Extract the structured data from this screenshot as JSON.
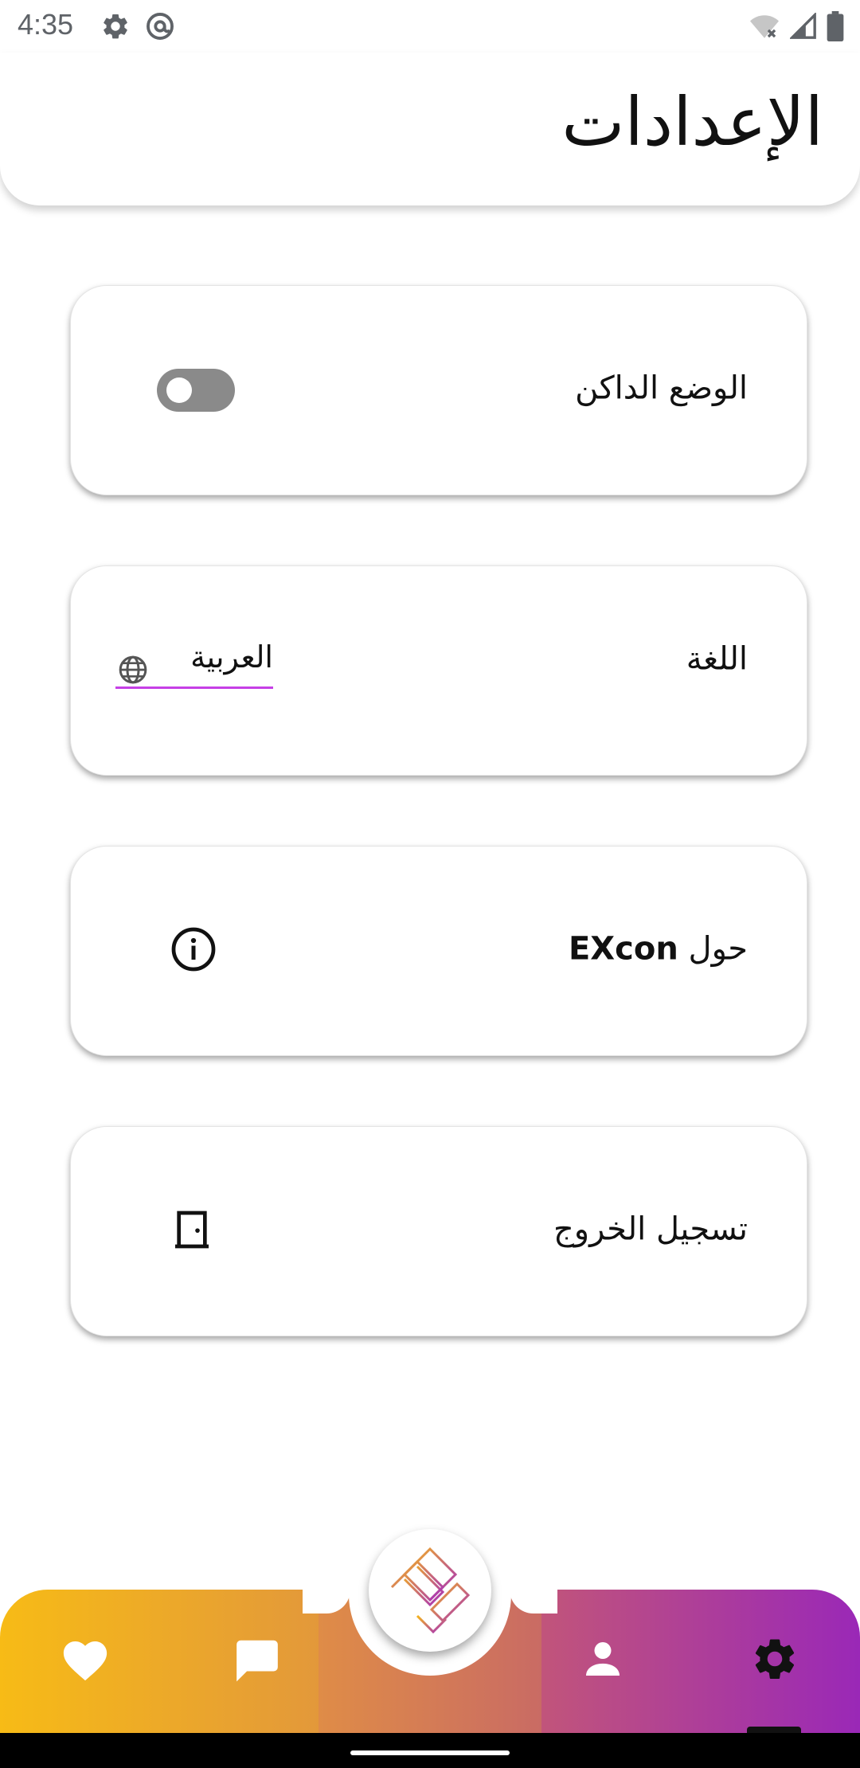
{
  "status_bar": {
    "time": "4:35",
    "left_icons": [
      "settings-icon",
      "at-sign-icon"
    ],
    "right_icons": [
      "wifi-off-icon",
      "signal-icon",
      "battery-icon"
    ]
  },
  "header": {
    "title": "الإعدادات"
  },
  "settings": {
    "dark_mode": {
      "label": "الوضع الداكن",
      "enabled": false
    },
    "language": {
      "label": "اللغة",
      "value": "العربية",
      "icon": "globe-icon",
      "underline_color": "#c640e6"
    },
    "about": {
      "label_prefix": "حول",
      "label_brand": "EXcon",
      "icon": "info-icon"
    },
    "logout": {
      "label": "تسجيل الخروج",
      "icon": "door-icon"
    }
  },
  "bottom_nav": {
    "items": [
      "heart-icon",
      "chat-icon",
      "logo-icon",
      "person-icon",
      "gear-icon"
    ],
    "active": "gear-icon",
    "gradient": [
      "#f7bb16",
      "#9a28b7"
    ]
  }
}
